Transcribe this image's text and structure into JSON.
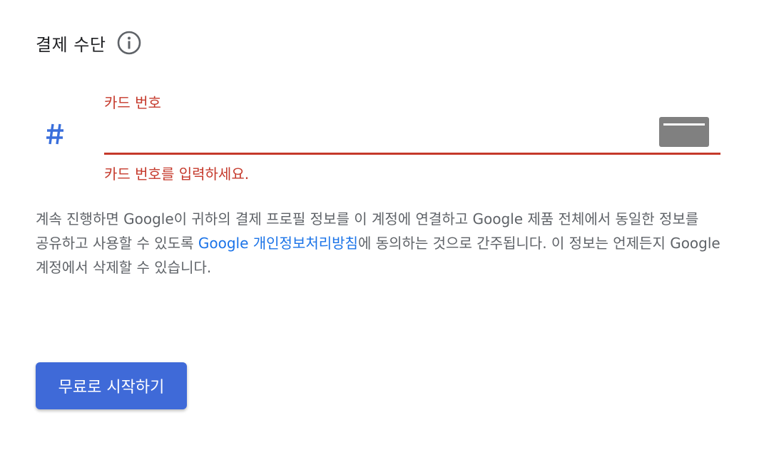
{
  "header": {
    "title": "결제 수단",
    "info_icon": "info-circle-icon"
  },
  "card_field": {
    "prefix_icon": "hash-icon",
    "label": "카드 번호",
    "value": "",
    "placeholder": "",
    "card_icon": "credit-card-icon",
    "error": "카드 번호를 입력하세요."
  },
  "disclaimer": {
    "text_before": "계속 진행하면 Google이 귀하의 결제 프로필 정보를 이 계정에 연결하고 Google 제품 전체에서 동일한 정보를 공유하고 사용할 수 있도록 ",
    "link": "Google 개인정보처리방침",
    "text_after": "에 동의하는 것으로 간주됩니다. 이 정보는 언제든지 Google 계정에서 삭제할 수 있습니다."
  },
  "actions": {
    "start_label": "무료로 시작하기"
  },
  "colors": {
    "error": "#c5392b",
    "primary_button": "#3f6ad8",
    "link": "#1a73e8",
    "hash_icon": "#3a6fdc",
    "card_icon": "#808080"
  }
}
